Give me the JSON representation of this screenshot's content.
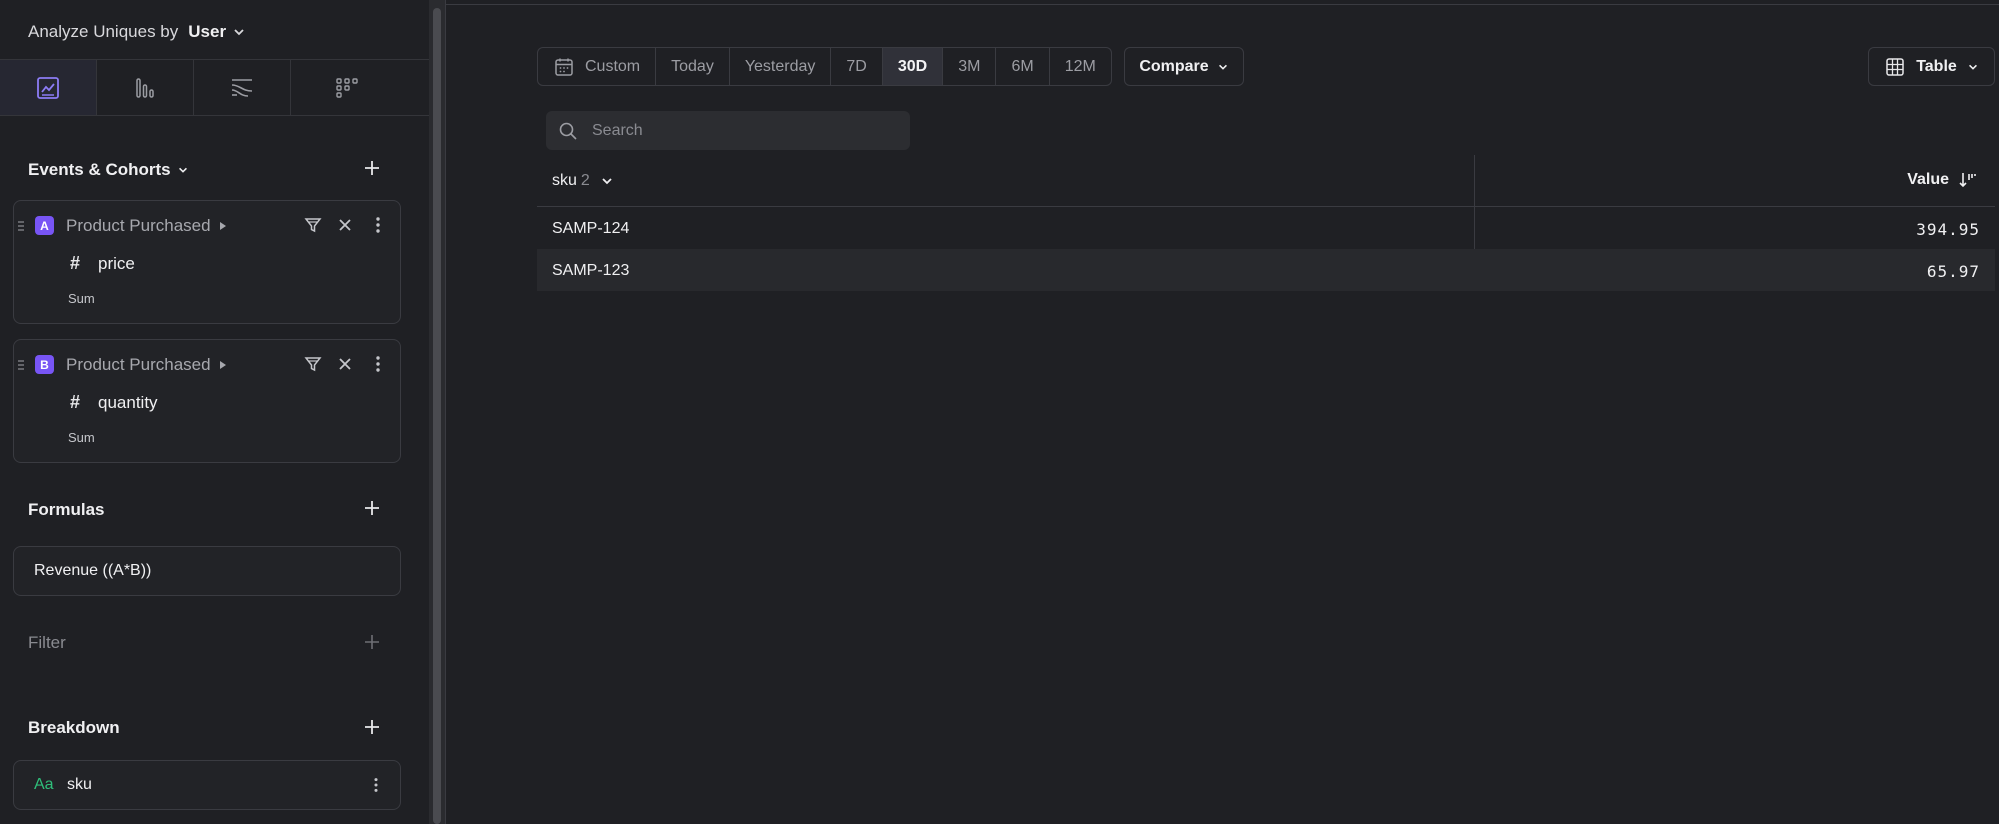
{
  "analyze": {
    "label": "Analyze Uniques by",
    "value": "User"
  },
  "sidebar_tabs": [
    "insights-chart-icon",
    "bar-chart-icon",
    "flows-icon",
    "retention-grid-icon"
  ],
  "events_section": {
    "title": "Events & Cohorts"
  },
  "events": [
    {
      "letter": "A",
      "name": "Product Purchased",
      "property_symbol": "#",
      "property": "price",
      "aggregation": "Sum"
    },
    {
      "letter": "B",
      "name": "Product Purchased",
      "property_symbol": "#",
      "property": "quantity",
      "aggregation": "Sum"
    }
  ],
  "formulas": {
    "title": "Formulas",
    "items": [
      "Revenue ((A*B))"
    ]
  },
  "filter": {
    "title": "Filter"
  },
  "breakdown": {
    "title": "Breakdown",
    "type_label": "Aa",
    "items": [
      "sku"
    ]
  },
  "date_range": {
    "options": [
      "Custom",
      "Today",
      "Yesterday",
      "7D",
      "30D",
      "3M",
      "6M",
      "12M"
    ],
    "selected": "30D"
  },
  "compare": {
    "label": "Compare"
  },
  "view": {
    "label": "Table"
  },
  "search": {
    "placeholder": "Search",
    "value": ""
  },
  "table": {
    "columns": {
      "group": "sku",
      "group_count": "2",
      "value": "Value"
    },
    "rows": [
      {
        "sku": "SAMP-124",
        "value": "394.95"
      },
      {
        "sku": "SAMP-123",
        "value": "65.97"
      }
    ]
  },
  "colors": {
    "accent": "#7855f5",
    "background": "#1f2024",
    "string_type": "#2fbf7a"
  }
}
